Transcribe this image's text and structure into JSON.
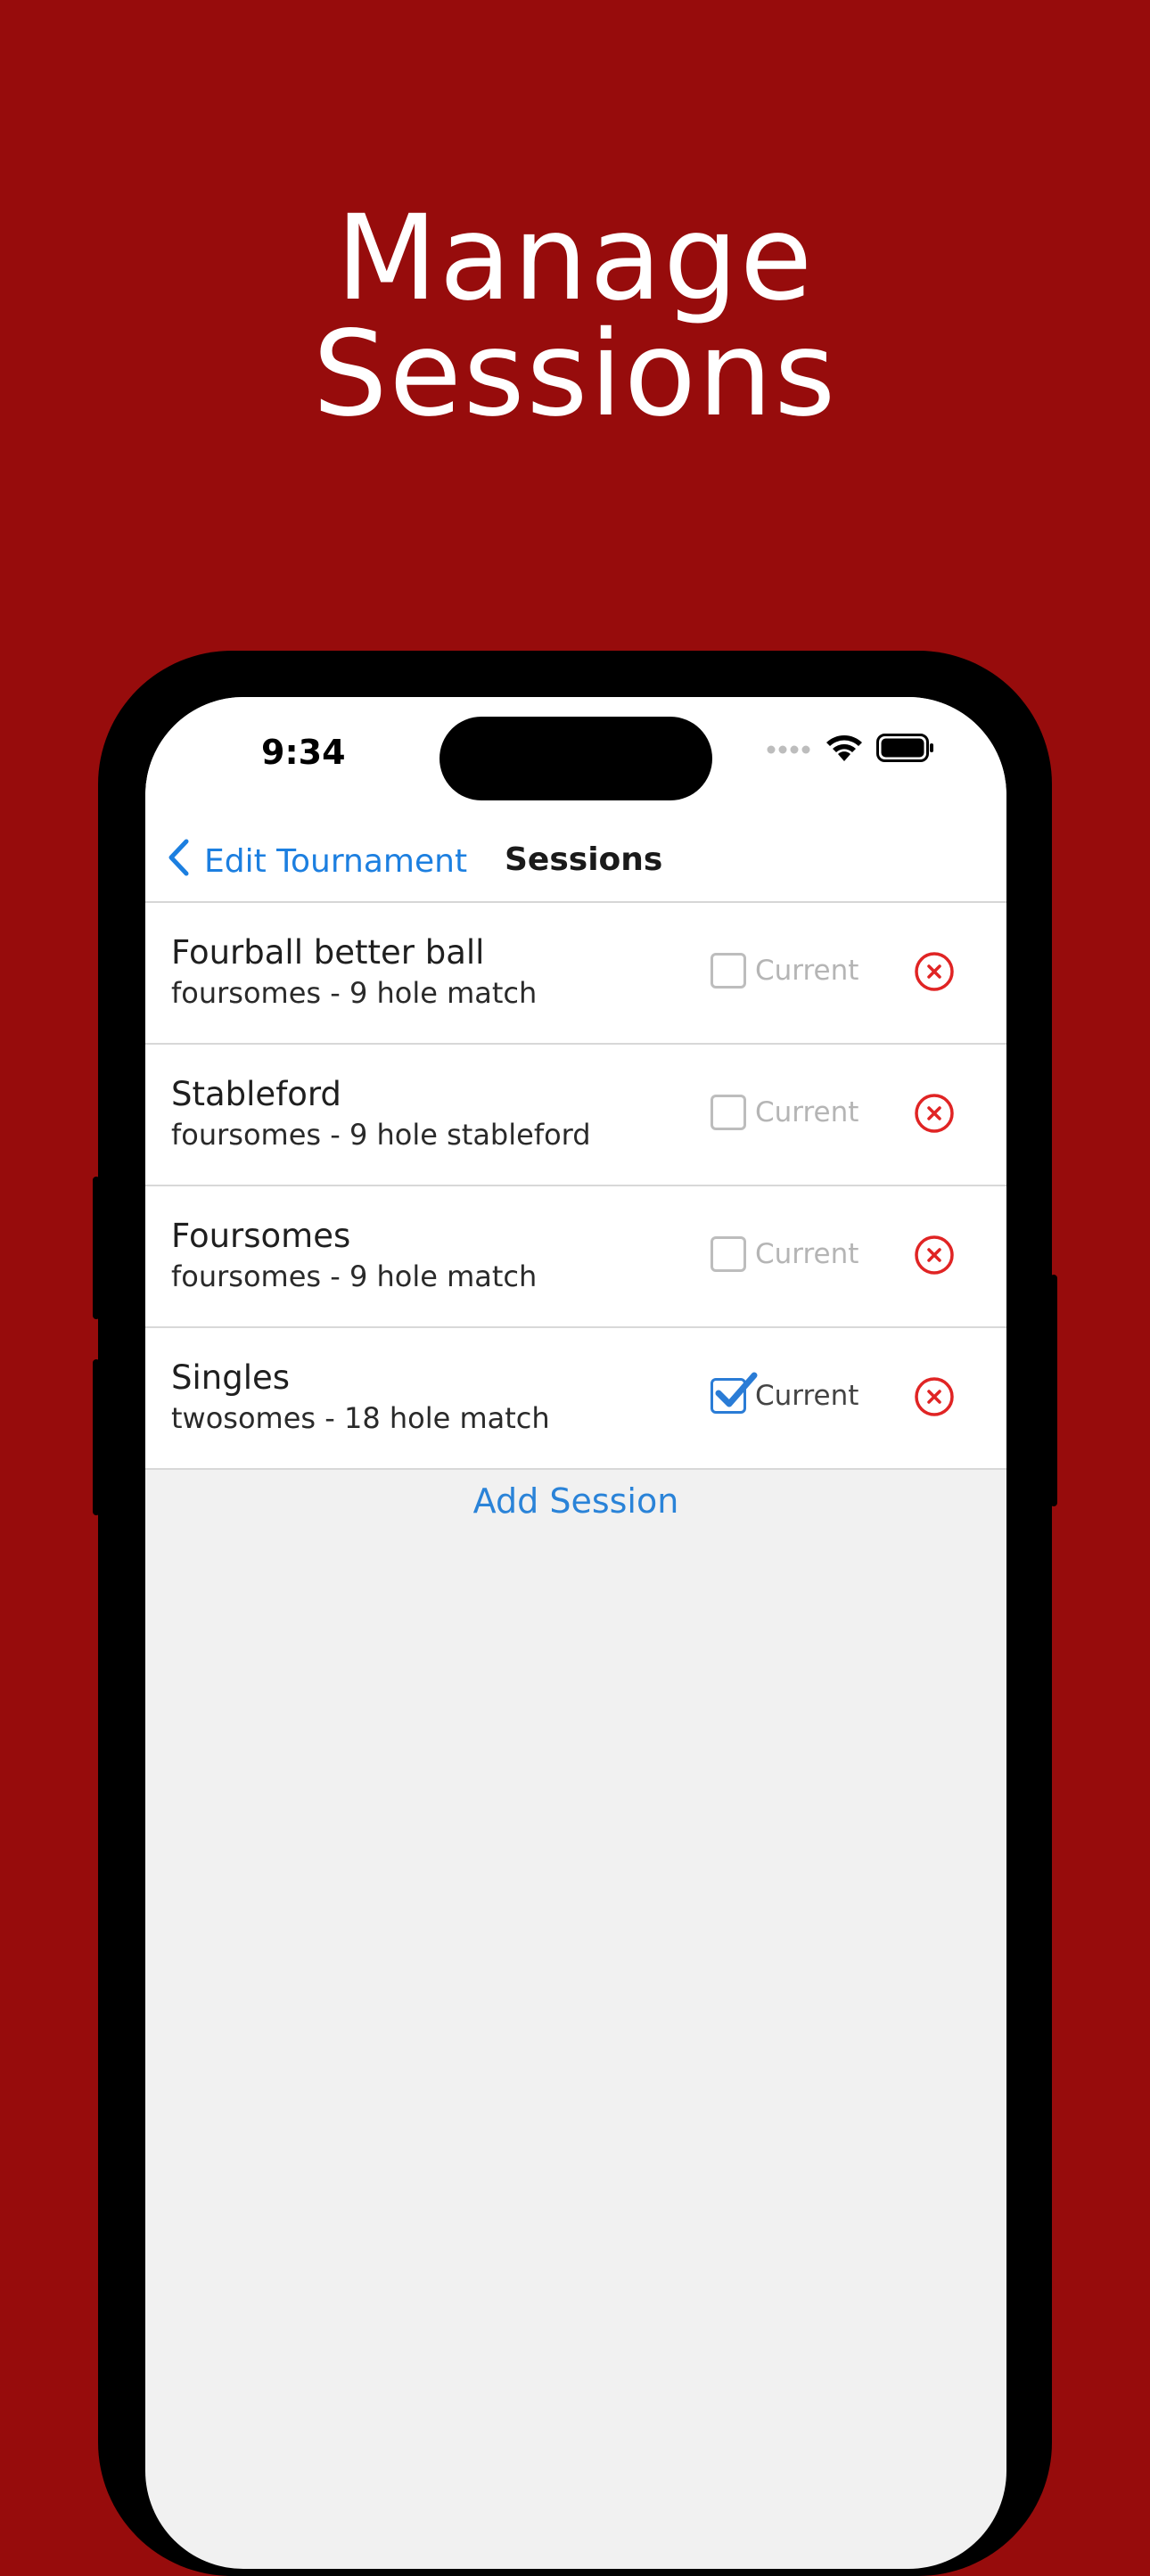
{
  "headline": {
    "line1": "Manage",
    "line2": "Sessions"
  },
  "status_bar": {
    "time": "9:34",
    "icons": [
      "cellular-dots-icon",
      "wifi-icon",
      "battery-icon"
    ]
  },
  "nav": {
    "back_label": "Edit Tournament",
    "title": "Sessions"
  },
  "sessions": [
    {
      "name": "Fourball better ball",
      "desc": "foursomes - 9 hole match",
      "current_label": "Current",
      "current": false
    },
    {
      "name": "Stableford",
      "desc": "foursomes - 9 hole stableford",
      "current_label": "Current",
      "current": false
    },
    {
      "name": "Foursomes",
      "desc": "foursomes - 9 hole match",
      "current_label": "Current",
      "current": false
    },
    {
      "name": "Singles",
      "desc": "twosomes - 18 hole match",
      "current_label": "Current",
      "current": true
    }
  ],
  "add_session_label": "Add Session",
  "colors": {
    "background": "#970C0C",
    "accent_blue": "#1C7FE0",
    "delete_red": "#E02424"
  }
}
